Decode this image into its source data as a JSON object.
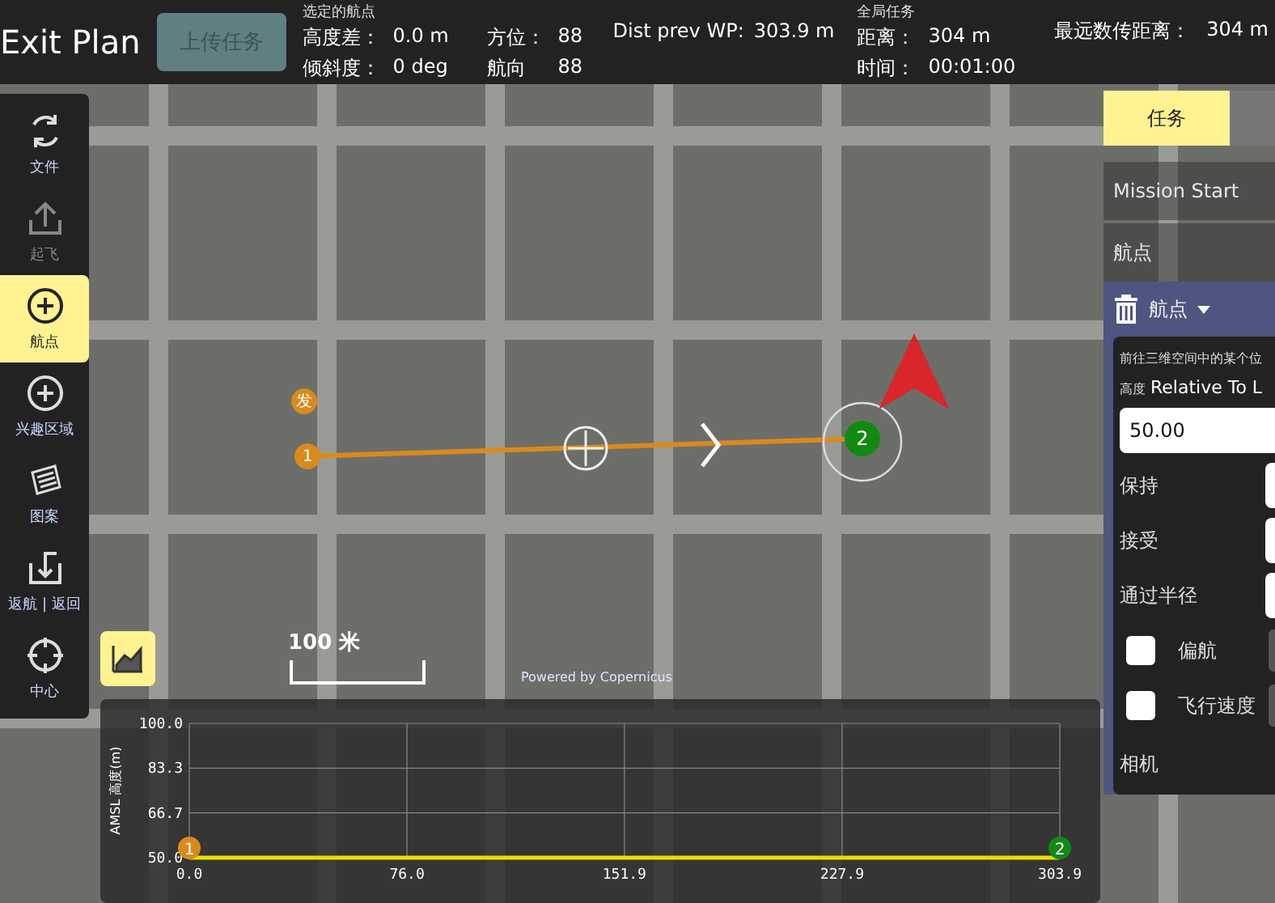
{
  "top_bar": {
    "exit_label": "Exit Plan",
    "upload_button": {
      "label": "上传任务",
      "disabled": true
    },
    "selected_waypoint": {
      "title": "选定的航点",
      "fields": [
        {
          "label": "高度差：",
          "value": "0.0 m"
        },
        {
          "label": "方位：",
          "value": "88"
        },
        {
          "label": "倾斜度：",
          "value": "0 deg"
        },
        {
          "label": "航向",
          "value": "88"
        }
      ],
      "dist_label": "Dist prev WP:",
      "dist_value": "303.9 m"
    },
    "mission_total": {
      "title": "全局任务",
      "fields": [
        {
          "label": "距离：",
          "value": "304 m"
        },
        {
          "label": "时间：",
          "value": "00:01:00"
        }
      ],
      "max_label": "最远数传距离：",
      "max_value": "304 m"
    }
  },
  "toolbar": [
    {
      "kind": "sync",
      "label": "文件",
      "selected": false,
      "disabled": false
    },
    {
      "kind": "takeoff",
      "label": "起飞",
      "selected": false,
      "disabled": true
    },
    {
      "kind": "plus",
      "label": "航点",
      "selected": true,
      "disabled": false
    },
    {
      "kind": "plus",
      "label": "兴趣区域",
      "selected": false,
      "disabled": false
    },
    {
      "kind": "pattern",
      "label": "图案",
      "selected": false,
      "disabled": false
    },
    {
      "kind": "return",
      "label": "返航 | 返回",
      "selected": false,
      "disabled": false
    },
    {
      "kind": "center",
      "label": "中心",
      "selected": false,
      "disabled": false
    }
  ],
  "map": {
    "launch_label": "发",
    "waypoints": [
      {
        "label": "1",
        "selected": false
      },
      {
        "label": "2",
        "selected": true
      }
    ],
    "scale_label": "100 米",
    "attribution": "Powered by Copernicus"
  },
  "mission_panel": {
    "tabs": [
      {
        "label": "任务",
        "selected": true
      },
      {
        "selected": false
      }
    ],
    "items": [
      {
        "label": "Mission Start"
      },
      {
        "label": "航点"
      }
    ],
    "editor": {
      "title": "航点",
      "description": "前往三维空间中的某个位",
      "altitude_label": "高度",
      "altitude_mode": "Relative To L",
      "altitude_value": "50.00",
      "rows": [
        {
          "kind": "field",
          "label": "保持"
        },
        {
          "kind": "field",
          "label": "接受"
        },
        {
          "kind": "field",
          "label": "通过半径"
        },
        {
          "kind": "check",
          "label": "偏航",
          "checked": false
        },
        {
          "kind": "check",
          "label": "飞行速度",
          "checked": false
        }
      ],
      "section": "相机"
    }
  },
  "elevation_chart": {
    "chart_data": {
      "type": "line",
      "ylabel": "AMSL 高度(m)",
      "x": [
        0,
        303.9
      ],
      "grid": true,
      "series": [
        {
          "color": "#e8e000",
          "values": [
            50,
            50
          ]
        }
      ],
      "xlim": [
        0,
        303.9
      ],
      "ylim": [
        50,
        100
      ],
      "xticks": [
        {
          "value": 0,
          "label": "0.0"
        },
        {
          "value": 76,
          "label": "76.0"
        },
        {
          "value": 151.9,
          "label": "151.9"
        },
        {
          "value": 227.9,
          "label": "227.9"
        },
        {
          "value": 303.9,
          "label": "303.9"
        }
      ],
      "yticks": [
        {
          "value": 50,
          "label": "50.0"
        },
        {
          "value": 66.7,
          "label": "66.7"
        },
        {
          "value": 83.3,
          "label": "83.3"
        },
        {
          "value": 100,
          "label": "100.0"
        }
      ]
    },
    "markers": [
      {
        "label": "1",
        "selected": false
      },
      {
        "label": "2",
        "selected": true
      }
    ]
  }
}
